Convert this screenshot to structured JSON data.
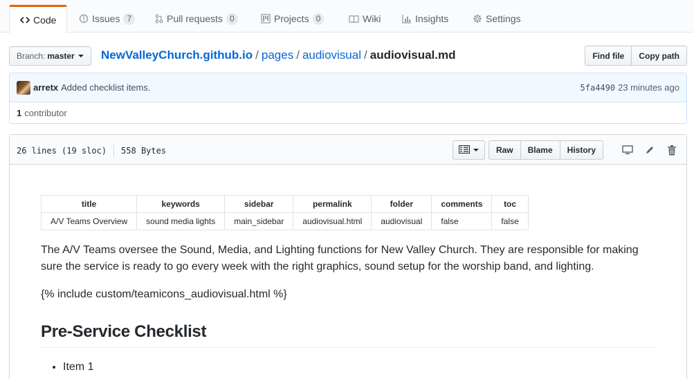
{
  "tabs": [
    {
      "label": "Code",
      "icon": "code-icon",
      "selected": true
    },
    {
      "label": "Issues",
      "icon": "issue-icon",
      "count": "7"
    },
    {
      "label": "Pull requests",
      "icon": "pull-request-icon",
      "count": "0"
    },
    {
      "label": "Projects",
      "icon": "project-icon",
      "count": "0"
    },
    {
      "label": "Wiki",
      "icon": "book-icon"
    },
    {
      "label": "Insights",
      "icon": "graph-icon"
    },
    {
      "label": "Settings",
      "icon": "gear-icon"
    }
  ],
  "branch": {
    "prefix": "Branch:",
    "name": "master"
  },
  "breadcrumb": {
    "repo": "NewValleyChurch.github.io",
    "sep": "/",
    "dir1": "pages",
    "dir2": "audiovisual",
    "file": "audiovisual.md"
  },
  "file_nav": {
    "find_file": "Find file",
    "copy_path": "Copy path"
  },
  "commit": {
    "author": "arretx",
    "message": "Added checklist items.",
    "sha": "5fa4490",
    "time": "23 minutes ago"
  },
  "contributors": {
    "count": "1",
    "label": "contributor"
  },
  "file_header": {
    "lines": "26 lines (19 sloc)",
    "size": "558 Bytes",
    "raw": "Raw",
    "blame": "Blame",
    "history": "History"
  },
  "frontmatter": {
    "headers": [
      "title",
      "keywords",
      "sidebar",
      "permalink",
      "folder",
      "comments",
      "toc"
    ],
    "values": [
      "A/V Teams Overview",
      "sound media lights",
      "main_sidebar",
      "audiovisual.html",
      "audiovisual",
      "false",
      "false"
    ]
  },
  "content": {
    "paragraph": "The A/V Teams oversee the Sound, Media, and Lighting functions for New Valley Church. They are responsible for making sure the service is ready to go every week with the right graphics, sound setup for the worship band, and lighting.",
    "include": "{% include custom/teamicons_audiovisual.html %}",
    "heading": "Pre-Service Checklist",
    "items": [
      "Item 1"
    ]
  },
  "colors": {
    "accent": "#e36209",
    "link": "#0366d6",
    "commit_bg": "#f1f8ff"
  }
}
